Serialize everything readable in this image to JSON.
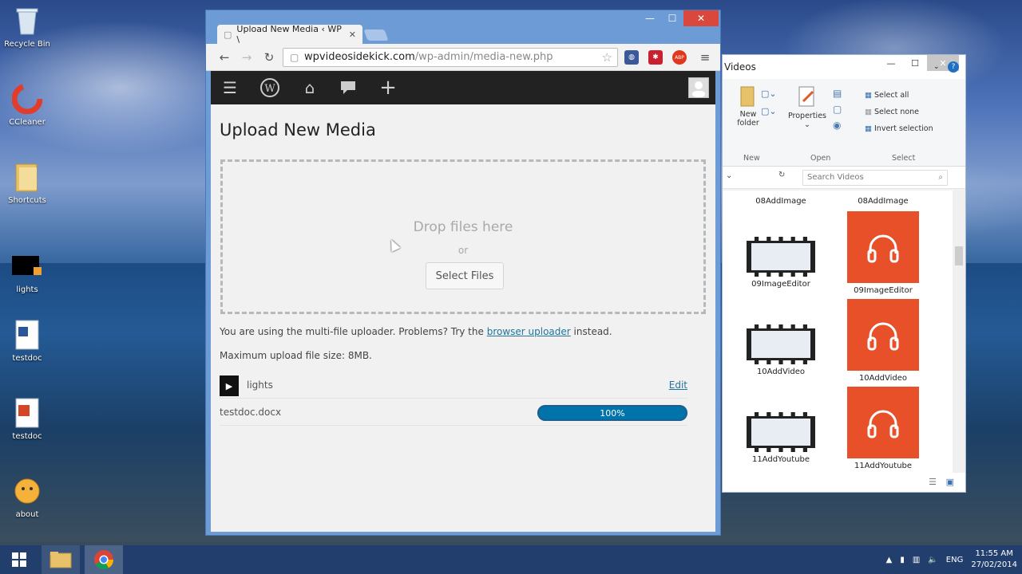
{
  "desktop": {
    "icons": [
      {
        "label": "Recycle Bin"
      },
      {
        "label": "CCleaner"
      },
      {
        "label": "Shortcuts"
      },
      {
        "label": "lights"
      },
      {
        "label": "testdoc"
      },
      {
        "label": "testdoc"
      },
      {
        "label": "about"
      }
    ]
  },
  "taskbar": {
    "lang": "ENG",
    "time": "11:55 AM",
    "date": "27/02/2014"
  },
  "explorer": {
    "title": "Videos",
    "ribbon": {
      "new_folder": "New folder",
      "properties": "Properties",
      "select_all": "Select all",
      "select_none": "Select none",
      "invert_selection": "Invert selection",
      "group_new": "New",
      "group_open": "Open",
      "group_select": "Select"
    },
    "search_placeholder": "Search Videos",
    "items": [
      {
        "label": "08AddImage"
      },
      {
        "label": "08AddImage"
      },
      {
        "label": "09ImageEditor"
      },
      {
        "label": "09ImageEditor"
      },
      {
        "label": "10AddVideo"
      },
      {
        "label": "10AddVideo"
      },
      {
        "label": "11AddYoutube"
      },
      {
        "label": "11AddYoutube"
      }
    ]
  },
  "browser": {
    "tab_title": "Upload New Media ‹ WP \\",
    "url_host": "wpvideosidekick.com",
    "url_path": "/wp-admin/media-new.php",
    "ext_badge": "ABP"
  },
  "page": {
    "title": "Upload New Media",
    "drop_text": "Drop files here",
    "drop_or": "or",
    "select_files": "Select Files",
    "uploader_text_pre": "You are using the multi-file uploader. Problems? Try the",
    "uploader_link": "browser uploader",
    "uploader_text_post": "instead.",
    "max_size": "Maximum upload file size: 8MB.",
    "items": [
      {
        "name": "lights",
        "action": "Edit"
      },
      {
        "name": "testdoc.docx",
        "progress_label": "100%"
      }
    ]
  }
}
